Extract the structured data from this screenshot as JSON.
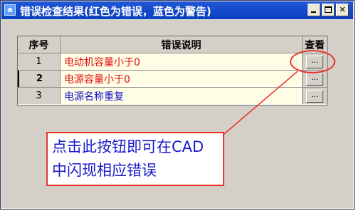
{
  "window": {
    "title": "错误检查结果(红色为错误，蓝色为警告)",
    "app_icon_glyph": "a",
    "controls": [
      "minimize",
      "maximize",
      "close"
    ]
  },
  "table": {
    "headers": [
      "序号",
      "错误说明",
      "查看"
    ],
    "rows": [
      {
        "num": "1",
        "desc": "电动机容量小于0",
        "type": "error",
        "view": "..."
      },
      {
        "num": "2",
        "desc": "电源容量小于0",
        "type": "error",
        "view": "..."
      },
      {
        "num": "3",
        "desc": "电源名称重复",
        "type": "warning",
        "view": "..."
      }
    ]
  },
  "callout": {
    "line1": "点击此按钮即可在CAD",
    "line2": "中闪现相应错误"
  },
  "colors": {
    "error": "#e01010",
    "warning": "#1010d0",
    "annotation": "#e8332b",
    "titlebar": "#0a3fbf"
  }
}
